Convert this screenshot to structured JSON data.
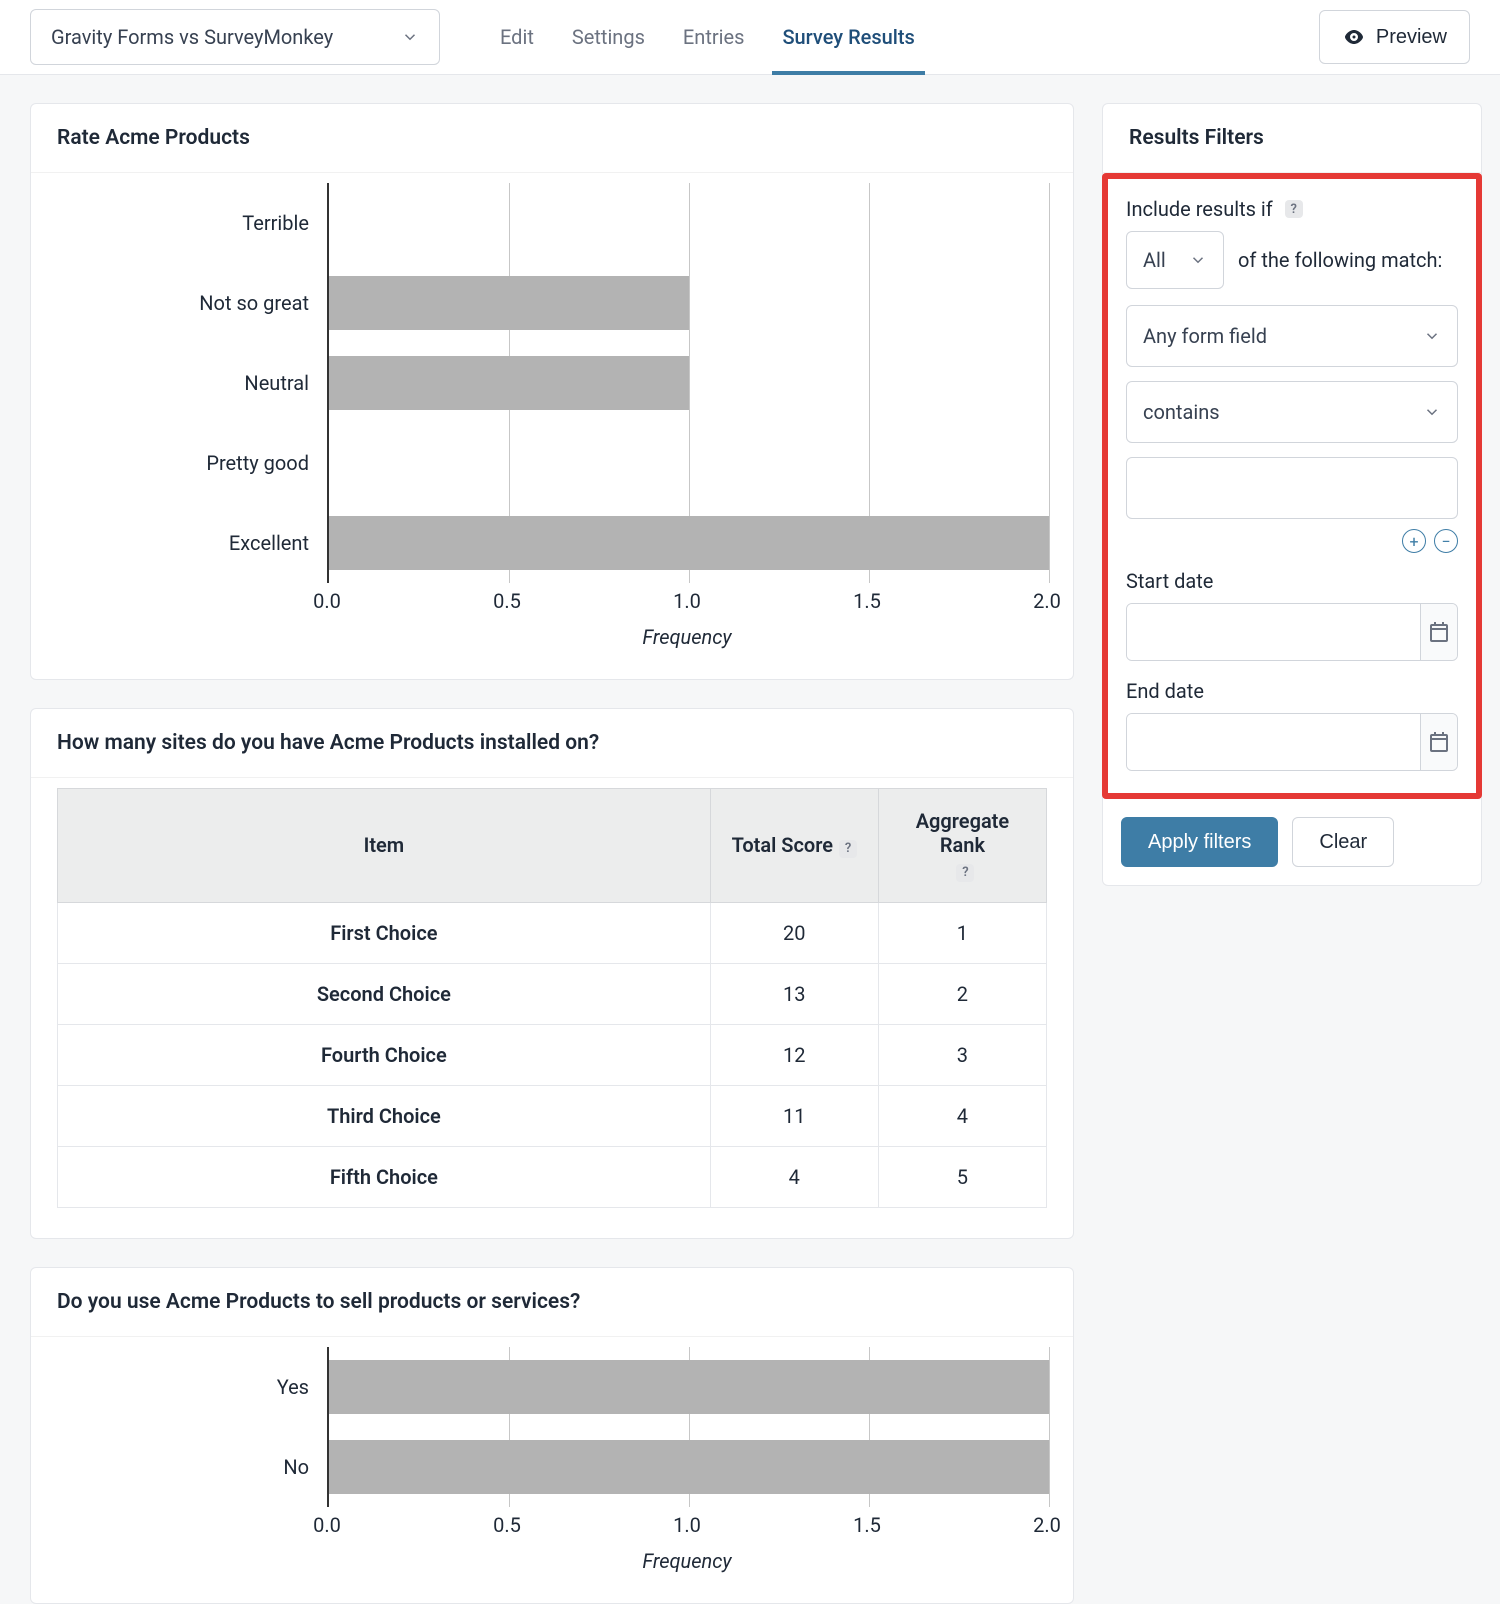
{
  "header": {
    "form_selector": "Gravity Forms vs SurveyMonkey",
    "tabs": [
      "Edit",
      "Settings",
      "Entries",
      "Survey Results"
    ],
    "active_tab": "Survey Results",
    "preview_label": "Preview"
  },
  "chart_data": [
    {
      "type": "bar",
      "orientation": "horizontal",
      "title": "Rate Acme Products",
      "categories": [
        "Terrible",
        "Not so great",
        "Neutral",
        "Pretty good",
        "Excellent"
      ],
      "values": [
        0,
        1.0,
        1.0,
        0,
        2.0
      ],
      "xlabel": "Frequency",
      "ylabel": "",
      "xlim": [
        0,
        2.0
      ],
      "xticks": [
        0.0,
        0.5,
        1.0,
        1.5,
        2.0
      ],
      "xtick_labels": [
        "0.0",
        "0.5",
        "1.0",
        "1.5",
        "2.0"
      ]
    },
    {
      "type": "table",
      "title": "How many sites do you have Acme Products installed on?",
      "columns": [
        "Item",
        "Total Score",
        "Aggregate Rank"
      ],
      "rows": [
        {
          "item": "First Choice",
          "total_score": 20,
          "aggregate_rank": 1
        },
        {
          "item": "Second Choice",
          "total_score": 13,
          "aggregate_rank": 2
        },
        {
          "item": "Fourth Choice",
          "total_score": 12,
          "aggregate_rank": 3
        },
        {
          "item": "Third Choice",
          "total_score": 11,
          "aggregate_rank": 4
        },
        {
          "item": "Fifth Choice",
          "total_score": 4,
          "aggregate_rank": 5
        }
      ]
    },
    {
      "type": "bar",
      "orientation": "horizontal",
      "title": "Do you use Acme Products to sell products or services?",
      "categories": [
        "Yes",
        "No"
      ],
      "values": [
        2.0,
        2.0
      ],
      "xlabel": "Frequency",
      "ylabel": "",
      "xlim": [
        0,
        2.0
      ],
      "xticks": [
        0.0,
        0.5,
        1.0,
        1.5,
        2.0
      ],
      "xtick_labels": [
        "0.0",
        "0.5",
        "1.0",
        "1.5",
        "2.0"
      ]
    }
  ],
  "filters": {
    "panel_title": "Results Filters",
    "include_label": "Include results if",
    "match_mode": "All",
    "match_suffix": "of the following match:",
    "field_select": "Any form field",
    "operator_select": "contains",
    "value_input": "",
    "start_date_label": "Start date",
    "start_date_value": "",
    "end_date_label": "End date",
    "end_date_value": "",
    "apply_label": "Apply filters",
    "clear_label": "Clear"
  }
}
